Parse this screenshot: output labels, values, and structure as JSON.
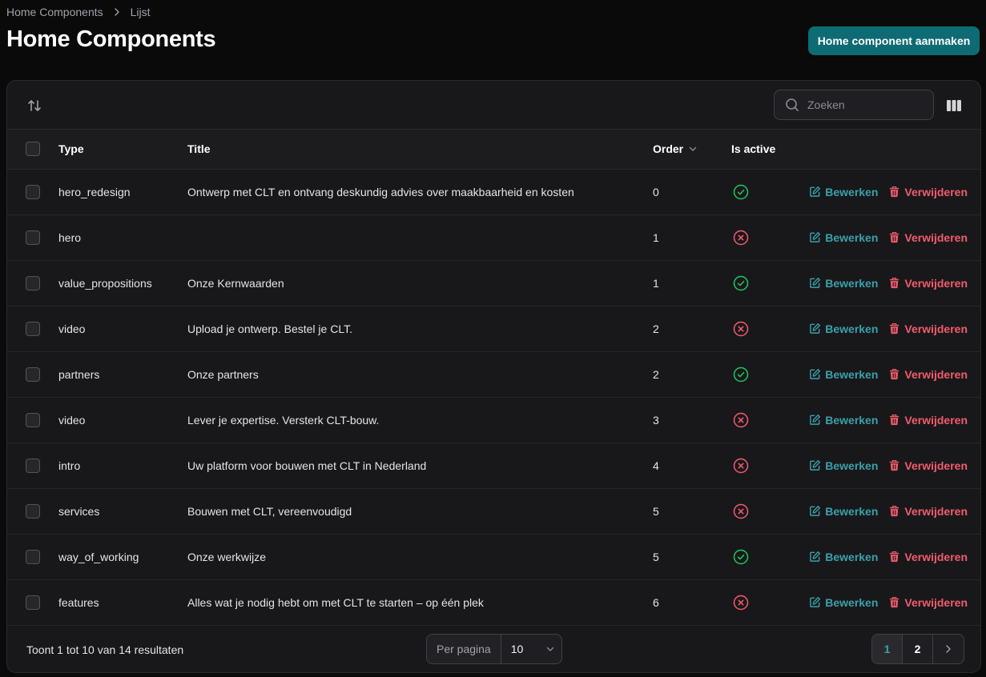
{
  "breadcrumb": {
    "parent": "Home Components",
    "current": "Lijst"
  },
  "page": {
    "title": "Home Components",
    "create_button": "Home component aanmaken"
  },
  "toolbar": {
    "search_placeholder": "Zoeken"
  },
  "table": {
    "headers": {
      "type": "Type",
      "title": "Title",
      "order": "Order",
      "is_active": "Is active"
    },
    "edit_label": "Bewerken",
    "delete_label": "Verwijderen",
    "rows": [
      {
        "type": "hero_redesign",
        "title": "Ontwerp met CLT en ontvang deskundig advies over maakbaarheid en kosten",
        "order": "0",
        "active": true
      },
      {
        "type": "hero",
        "title": "",
        "order": "1",
        "active": false
      },
      {
        "type": "value_propositions",
        "title": "Onze Kernwaarden",
        "order": "1",
        "active": true
      },
      {
        "type": "video",
        "title": "Upload je ontwerp. Bestel je CLT.",
        "order": "2",
        "active": false
      },
      {
        "type": "partners",
        "title": "Onze partners",
        "order": "2",
        "active": true
      },
      {
        "type": "video",
        "title": "Lever je expertise. Versterk CLT-bouw.",
        "order": "3",
        "active": false
      },
      {
        "type": "intro",
        "title": "Uw platform voor bouwen met CLT in Nederland",
        "order": "4",
        "active": false
      },
      {
        "type": "services",
        "title": "Bouwen met CLT, vereenvoudigd",
        "order": "5",
        "active": false
      },
      {
        "type": "way_of_working",
        "title": "Onze werkwijze",
        "order": "5",
        "active": true
      },
      {
        "type": "features",
        "title": "Alles wat je nodig hebt om met CLT te starten – op één plek",
        "order": "6",
        "active": false
      }
    ]
  },
  "footer": {
    "summary": "Toont 1 tot 10 van 14 resultaten",
    "per_page_label": "Per pagina",
    "per_page_value": "10",
    "pages": [
      "1",
      "2"
    ],
    "current_page": "1"
  },
  "colors": {
    "accent": "#0f6b73",
    "link": "#3aa1aa",
    "danger": "#f25c6b",
    "success": "#22c55e"
  }
}
